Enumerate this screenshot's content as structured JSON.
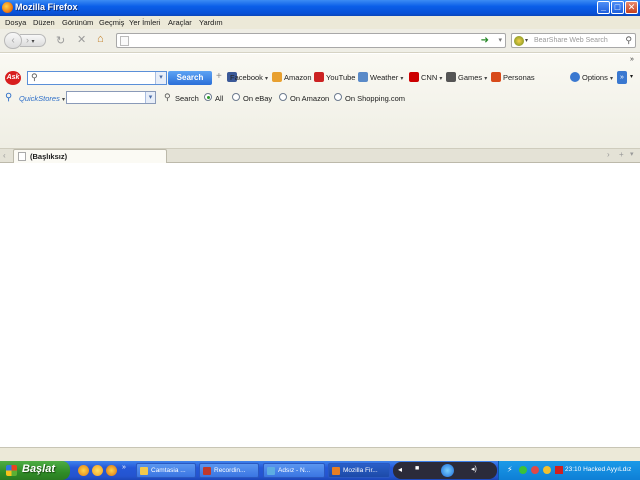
{
  "window": {
    "title": "Mozilla Firefox",
    "controls": {
      "minimize": "_",
      "maximize": "□",
      "close": "✕"
    }
  },
  "menu": {
    "items": [
      "Dosya",
      "Düzen",
      "Görünüm",
      "Geçmiş",
      "Yer İmleri",
      "Araçlar",
      "Yardım"
    ]
  },
  "navigation": {
    "back_label": "‹",
    "forward_label": "›",
    "url_value": "",
    "search_placeholder": "BearShare Web Search"
  },
  "ask_toolbar": {
    "logo_text": "Ask",
    "search_value": "",
    "search_button": "Search",
    "buttons": [
      {
        "label": "Facebook",
        "icon": "facebook-icon",
        "color": "#3b5998",
        "has_menu": true
      },
      {
        "label": "Amazon",
        "icon": "amazon-icon",
        "color": "#222222",
        "has_menu": false
      },
      {
        "label": "YouTube",
        "icon": "youtube-icon",
        "color": "#cc2222",
        "has_menu": false
      },
      {
        "label": "Weather",
        "icon": "weather-icon",
        "color": "#5a8ac8",
        "has_menu": true
      },
      {
        "label": "CNN",
        "icon": "cnn-icon",
        "color": "#cc0000",
        "has_menu": true
      },
      {
        "label": "Games",
        "icon": "games-icon",
        "color": "#555555",
        "has_menu": true
      },
      {
        "label": "Personas",
        "icon": "personas-icon",
        "color": "#d84a1a",
        "has_menu": false
      }
    ],
    "options_label": "Options",
    "quickstores": {
      "label": "QuickStores",
      "select_value": "",
      "search_label": "Search",
      "scopes": [
        {
          "label": "All",
          "checked": true
        },
        {
          "label": "On eBay",
          "checked": false
        },
        {
          "label": "On Amazon",
          "checked": false
        },
        {
          "label": "On Shopping.com",
          "checked": false
        }
      ]
    }
  },
  "tabs": [
    {
      "title": "(Başlıksız)",
      "active": true
    }
  ],
  "taskbar": {
    "start_label": "Başlat",
    "tasks": [
      {
        "label": "Camtasia ...",
        "icon_color": "#f2c94c"
      },
      {
        "label": "Recordin...",
        "icon_color": "#c0392b"
      },
      {
        "label": "Adsız - N...",
        "icon_color": "#5dade2"
      },
      {
        "label": "Mozilla Fir...",
        "icon_color": "#e67e22"
      }
    ],
    "clock": "23:10 Hacked AyyıLdız"
  },
  "colors": {
    "titlebar": "#0a5ee8",
    "taskbar": "#2454cf",
    "start": "#2f8d27",
    "ask_search_button": "#2a6fd8",
    "ask_logo": "#d81e1e"
  }
}
